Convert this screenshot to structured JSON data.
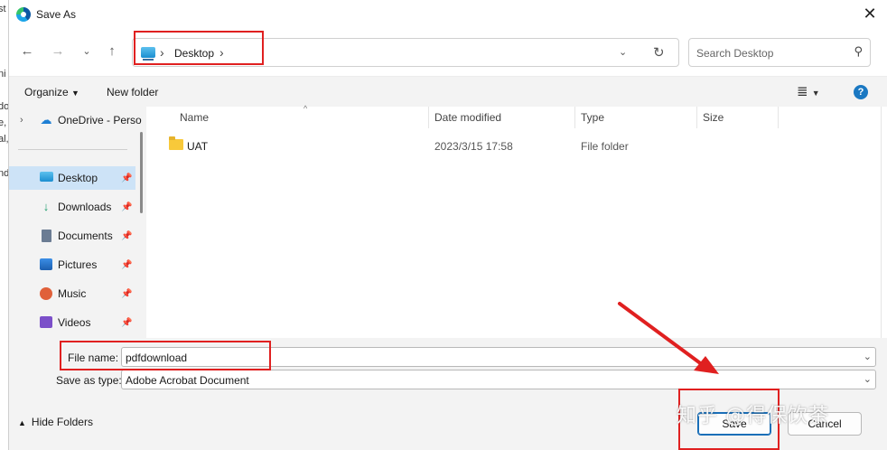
{
  "left_edge_fragments": [
    "st",
    "ni",
    "do",
    "e,",
    "al,",
    "nd"
  ],
  "window": {
    "title": "Save As"
  },
  "navigation": {
    "back_icon": "arrow-left-icon",
    "forward_icon": "arrow-right-icon",
    "recent_icon": "chevron-down-icon",
    "up_icon": "arrow-up-icon",
    "address_crumb": "Desktop",
    "search_placeholder": "Search Desktop"
  },
  "toolbar": {
    "organize": "Organize",
    "new_folder": "New folder"
  },
  "sidebar": {
    "items": [
      {
        "label": "OneDrive - Perso",
        "icon": "cloud-icon"
      },
      {
        "label": "Desktop",
        "icon": "desktop-icon",
        "selected": true
      },
      {
        "label": "Downloads",
        "icon": "download-icon"
      },
      {
        "label": "Documents",
        "icon": "document-icon"
      },
      {
        "label": "Pictures",
        "icon": "pictures-icon"
      },
      {
        "label": "Music",
        "icon": "music-icon"
      },
      {
        "label": "Videos",
        "icon": "videos-icon"
      }
    ]
  },
  "file_list": {
    "columns": [
      "Name",
      "Date modified",
      "Type",
      "Size"
    ],
    "rows": [
      {
        "name": "UAT",
        "date": "2023/3/15 17:58",
        "type": "File folder",
        "size": ""
      }
    ]
  },
  "form": {
    "file_name_label": "File name:",
    "file_name_value": "pdfdownload",
    "save_type_label": "Save as type:",
    "save_type_value": "Adobe Acrobat Document"
  },
  "footer": {
    "hide_folders": "Hide Folders",
    "save": "Save",
    "cancel": "Cancel"
  },
  "watermark": "知乎 @得保饮茶",
  "annotation_color": "#e02020"
}
